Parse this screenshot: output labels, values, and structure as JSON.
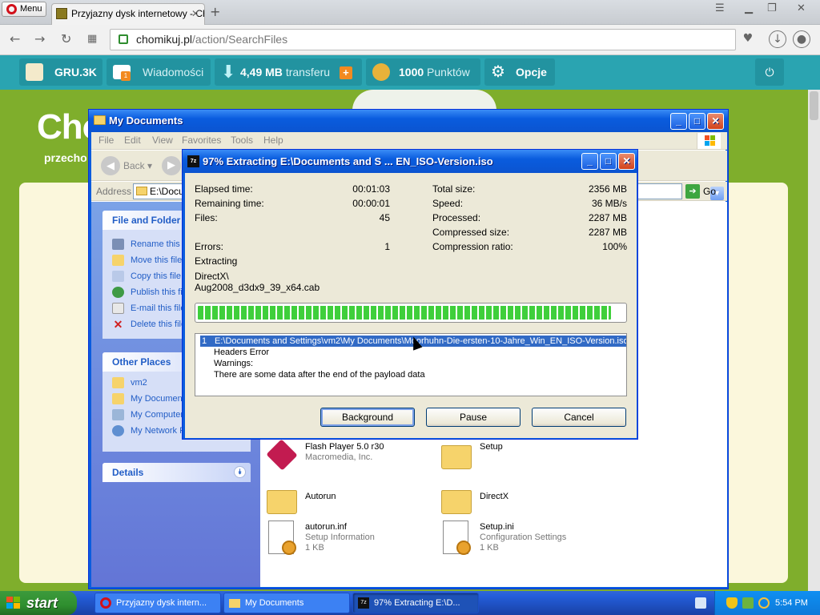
{
  "browser": {
    "menu_label": "Menu",
    "tab_title": "Przyjazny dysk internetowy - Chomikuj.pl",
    "tab_close": "✕",
    "new_tab": "+",
    "url_domain": "chomikuj.pl",
    "url_path": "/action/SearchFiles",
    "icons": [
      "back-icon",
      "forward-icon",
      "reload-icon",
      "speed-dial-icon",
      "lock-icon",
      "heart-icon",
      "download-icon",
      "account-icon"
    ]
  },
  "site": {
    "user": "GRU.3K",
    "messages_label": "Wiadomości",
    "messages_badge": "1",
    "transfer_value": "4,49 MB",
    "transfer_label": "transferu",
    "transfer_plus": "+",
    "points_value": "1000",
    "points_label": "Punktów",
    "options_label": "Opcje",
    "logo_text": "Cho",
    "sub_text": "przecho",
    "accent": "#2aa4b1",
    "background": "#7fae2c"
  },
  "explorer": {
    "title": "My Documents",
    "menu": [
      "File",
      "Edit",
      "View",
      "Favorites",
      "Tools",
      "Help"
    ],
    "back_label": "Back",
    "address_label": "Address",
    "address_value": "E:\\Docum",
    "go_label": "Go",
    "panels": {
      "file_folder": {
        "title": "File and Folder Tasks",
        "items": [
          "Rename this file",
          "Move this file",
          "Copy this file",
          "Publish this file to the Web",
          "E-mail this file",
          "Delete this file"
        ]
      },
      "other_places": {
        "title": "Other Places",
        "items": [
          "vm2",
          "My Documents",
          "My Computer",
          "My Network Places"
        ]
      },
      "details": {
        "title": "Details"
      }
    },
    "files": [
      {
        "name": "Flash Player 5.0 r30",
        "sub": "Macromedia, Inc."
      },
      {
        "name": "Setup",
        "sub": ""
      },
      {
        "name": "Autorun",
        "sub": ""
      },
      {
        "name": "DirectX",
        "sub": ""
      },
      {
        "name": "autorun.inf",
        "sub": "Setup Information",
        "sub2": "1 KB"
      },
      {
        "name": "Setup.ini",
        "sub": "Configuration Settings",
        "sub2": "1 KB"
      }
    ]
  },
  "zip": {
    "title": "97% Extracting E:\\Documents and S ... EN_ISO-Version.iso",
    "icon_text": "7z",
    "progress": 0.97,
    "left_stats": [
      {
        "label": "Elapsed time:",
        "value": "00:01:03"
      },
      {
        "label": "Remaining time:",
        "value": "00:00:01"
      },
      {
        "label": "Files:",
        "value": "45"
      }
    ],
    "errors_label": "Errors:",
    "errors_value": "1",
    "right_stats": [
      {
        "label": "Total size:",
        "value": "2356 MB"
      },
      {
        "label": "Speed:",
        "value": "36 MB/s"
      },
      {
        "label": "Processed:",
        "value": "2287 MB"
      },
      {
        "label": "Compressed size:",
        "value": "2287 MB"
      },
      {
        "label": "Compression ratio:",
        "value": "100%"
      }
    ],
    "status": "Extracting",
    "current_dir": "DirectX\\",
    "current_file": "Aug2008_d3dx9_39_x64.cab",
    "messages": {
      "num": "1",
      "path": "E:\\Documents and Settings\\vm2\\My Documents\\Moorhuhn-Die-ersten-10-Jahre_Win_EN_ISO-Version.iso",
      "lines": [
        "Headers Error",
        "Warnings:",
        "There are some data after the end of the payload data"
      ]
    },
    "buttons": {
      "background": "Background",
      "pause": "Pause",
      "cancel": "Cancel"
    }
  },
  "taskbar": {
    "start": "start",
    "tasks": [
      "Przyjazny dysk intern...",
      "My Documents",
      "97% Extracting E:\\D..."
    ],
    "clock": "5:54 PM"
  }
}
